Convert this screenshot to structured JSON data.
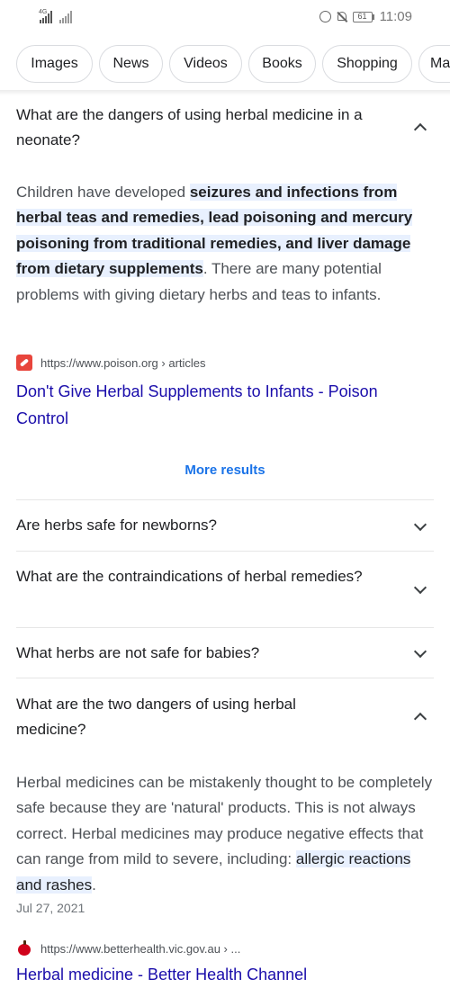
{
  "status_bar": {
    "network": "4G",
    "battery": "61",
    "time": "11:09"
  },
  "chips": [
    "Images",
    "News",
    "Videos",
    "Books",
    "Shopping",
    "Ma"
  ],
  "expanded_q1": {
    "question": "What are the dangers of using herbal medicine in a neonate?",
    "answer_pre": "Children have developed ",
    "answer_highlight": "seizures and infections from herbal teas and remedies, lead poisoning and mercury poisoning from traditional remedies, and liver damage from dietary supplements",
    "answer_post": ". There are many potential problems with giving dietary herbs and teas to infants.",
    "source_url": "https://www.poison.org › articles",
    "link_title": "Don't Give Herbal Supplements to Infants - Poison Control"
  },
  "more_results": "More results",
  "questions": [
    "Are herbs safe for newborns?",
    "What are the contraindications of herbal remedies?",
    "What herbs are not safe for babies?"
  ],
  "expanded_q2": {
    "question": "What are the two dangers of using herbal medicine?",
    "answer_pre": "Herbal medicines can be mistakenly thought to be completely safe because they are 'natural' products. This is not always correct. Herbal medicines may produce negative effects that can range from mild to severe, including: ",
    "answer_highlight": "allergic reactions and rashes",
    "answer_post": ".",
    "date": "Jul 27, 2021",
    "source_url": "https://www.betterhealth.vic.gov.au › ...",
    "link_title": "Herbal medicine - Better Health Channel"
  },
  "colors": {
    "link": "#1a0dab",
    "accent": "#1a73e8",
    "highlight": "#e8f0fe"
  }
}
